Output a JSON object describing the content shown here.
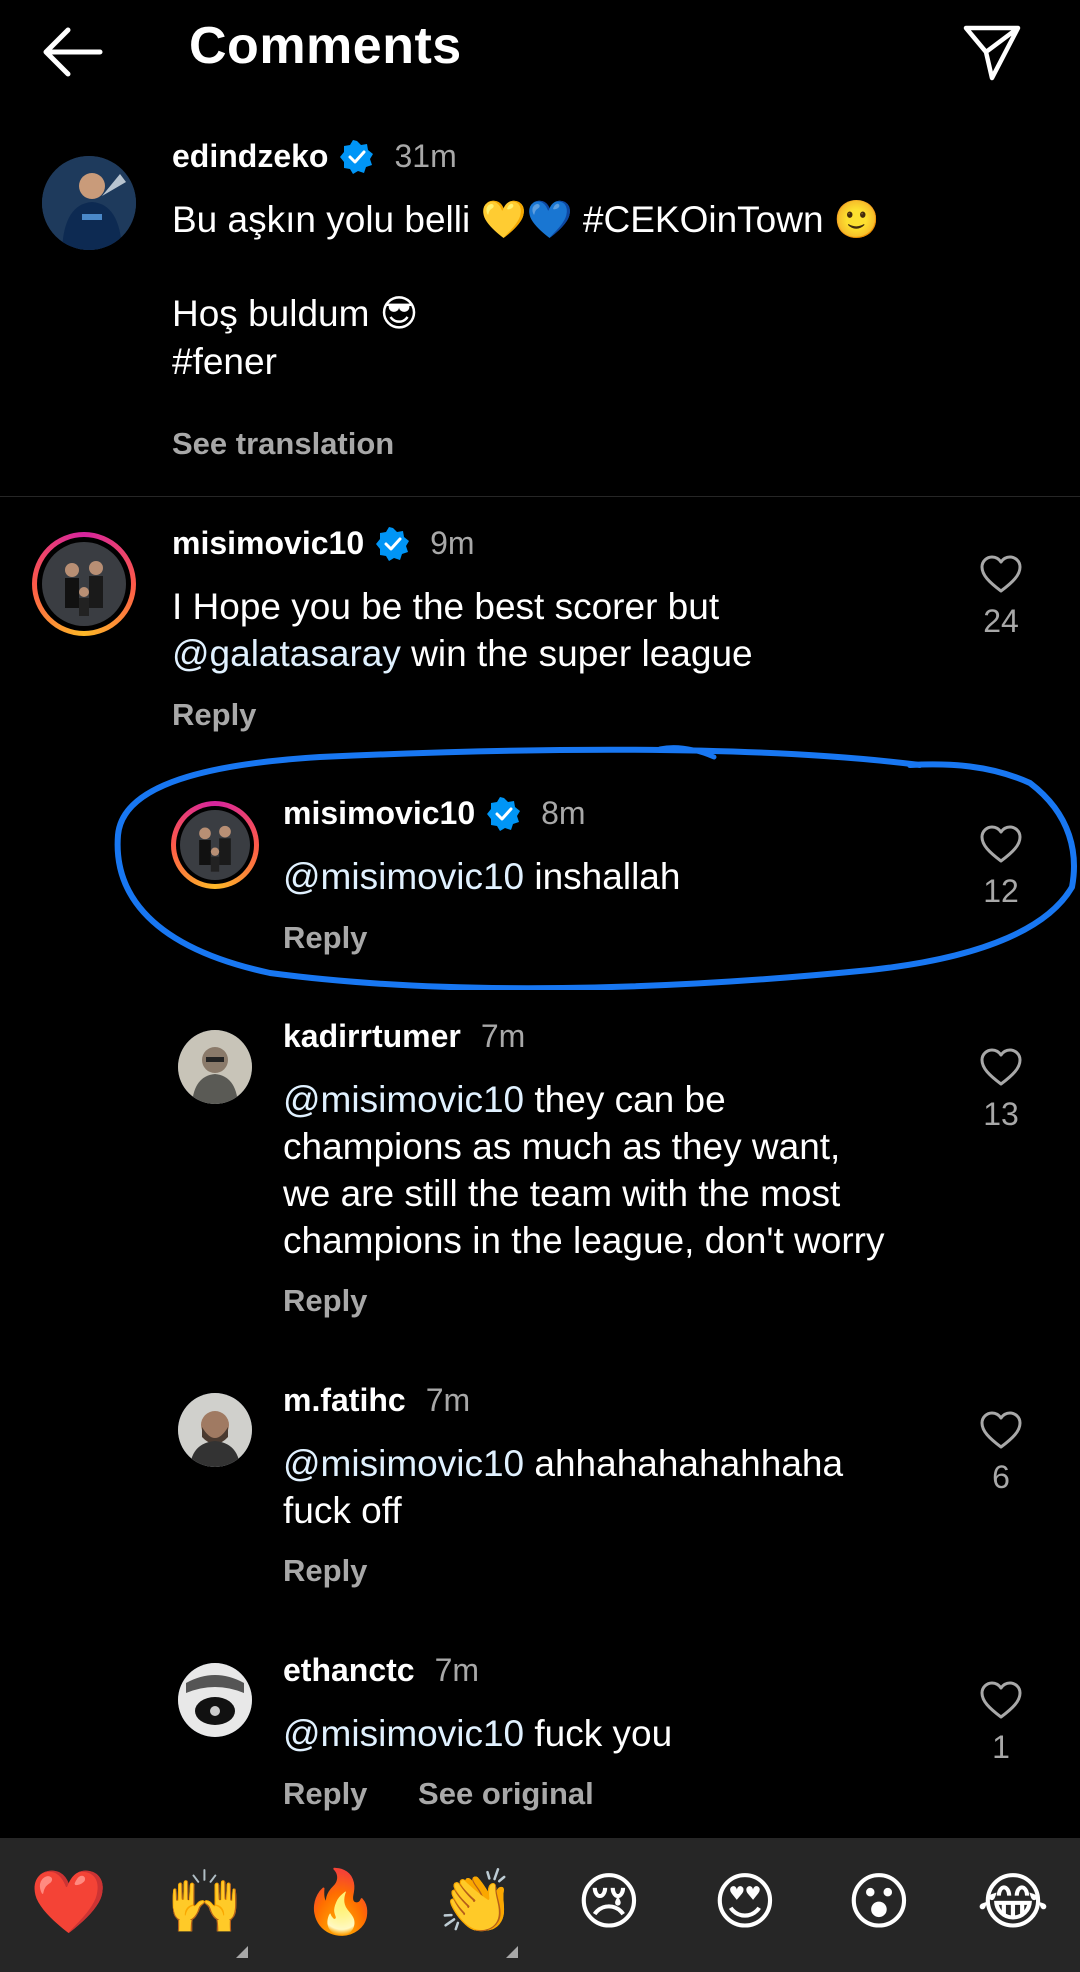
{
  "header": {
    "title": "Comments",
    "back_icon": "arrow-left-icon",
    "share_icon": "paper-plane-icon"
  },
  "caption": {
    "username": "edindzeko",
    "verified": true,
    "time": "31m",
    "line1": "Bu aşkın yolu belli 💛💙 #CEKOinTown 🙂",
    "line2": "Hoş buldum 😎",
    "line3": "#fener",
    "see_translation": "See translation"
  },
  "comments": [
    {
      "username": "misimovic10",
      "verified": true,
      "time": "9m",
      "text_a": "I Hope you be the best scorer but",
      "mention": "@galatasaray",
      "text_b": " win the super league",
      "reply_label": "Reply",
      "likes": "24"
    },
    {
      "username": "misimovic10",
      "verified": true,
      "time": "8m",
      "mention": "@misimovic10",
      "text": " inshallah",
      "reply_label": "Reply",
      "likes": "12"
    },
    {
      "username": "kadirrtumer",
      "time": "7m",
      "mention": "@misimovic10",
      "text": " they can be\nchampions as much as they want,\nwe are still the team with the most\nchampions in the league, don't worry",
      "reply_label": "Reply",
      "likes": "13"
    },
    {
      "username": "m.fatihc",
      "time": "7m",
      "mention": "@misimovic10",
      "text": " ahhahahahahhaha\nfuck off",
      "reply_label": "Reply",
      "likes": "6"
    },
    {
      "username": "ethanctc",
      "time": "7m",
      "mention": "@misimovic10",
      "text": " fuck you",
      "reply_label": "Reply",
      "see_original": "See original",
      "likes": "1"
    }
  ],
  "emoji_bar": [
    "❤️",
    "🙌",
    "🔥",
    "👏",
    "😢",
    "😍",
    "😮",
    "😂"
  ],
  "colors": {
    "background": "#000000",
    "secondary_text": "#a8a8a8",
    "verified": "#0095f6",
    "annotation": "#1877f2"
  }
}
